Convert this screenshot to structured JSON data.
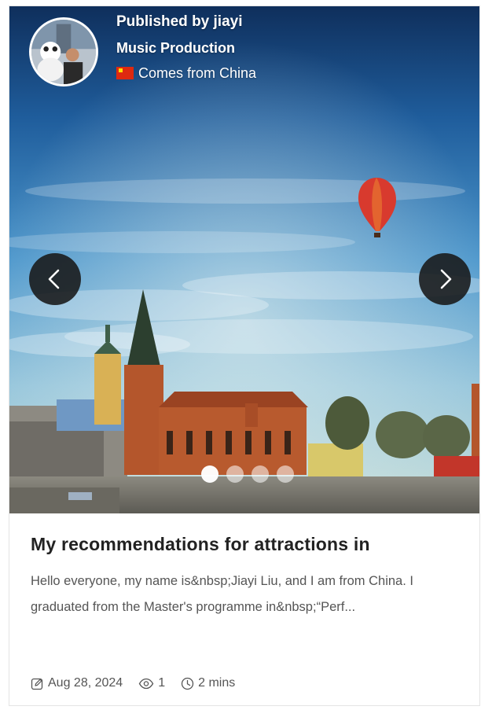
{
  "author": {
    "published_by": "Published by jiayi",
    "category": "Music Production",
    "origin": "Comes from China"
  },
  "carousel": {
    "total_slides": 4,
    "active_slide": 1,
    "prev_icon": "chevron-left-icon",
    "next_icon": "chevron-right-icon"
  },
  "post": {
    "title": "My recommendations for attractions in",
    "excerpt": "Hello everyone, my name is&nbsp;Jiayi Liu, and I am from China. I graduated from the Master's programme in&nbsp;“Perf...",
    "date": "Aug 28, 2024",
    "views": "1",
    "read_time": "2 mins"
  },
  "colors": {
    "nav_button": "#181818",
    "title_text": "#222222",
    "body_text": "#555555",
    "flag_red": "#de2910"
  }
}
